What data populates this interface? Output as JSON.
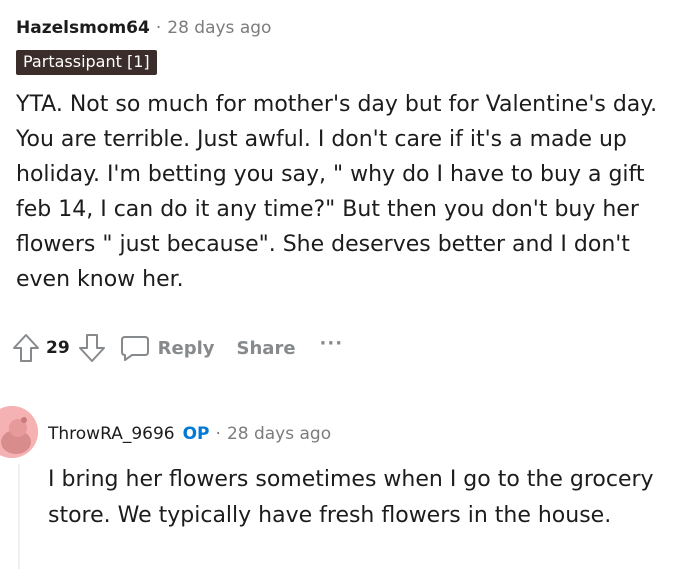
{
  "comment": {
    "username": "Hazelsmom64",
    "separator": "·",
    "timestamp": "28 days ago",
    "flair": "Partassipant [1]",
    "body": "YTA. Not so much for mother's day but for Valentine's day. You are terrible. Just awful. I don't care if it's a made up holiday. I'm betting you say, \" why do I have to buy a gift feb 14, I can do it any time?\" But then you don't buy her flowers \" just because\". She deserves better and I don't even know her.",
    "vote_count": "29",
    "reply_label": "Reply",
    "share_label": "Share",
    "more_label": "···",
    "icons": {
      "upvote": "upvote-arrow-icon",
      "downvote": "downvote-arrow-icon",
      "reply": "speech-bubble-icon"
    }
  },
  "reply": {
    "username": "ThrowRA_9696",
    "op_badge": "OP",
    "separator": "·",
    "timestamp": "28 days ago",
    "body": "I bring her flowers sometimes when I go to the grocery store. We typically have fresh flowers in the house.",
    "avatar_icon": "snoo-avatar-icon"
  },
  "colors": {
    "text": "#1c1c1c",
    "meta": "#7c7c7c",
    "action": "#878a8c",
    "op_blue": "#0079d3",
    "flair_bg": "#3a2d2a",
    "avatar_bg": "#f6b2b2"
  }
}
